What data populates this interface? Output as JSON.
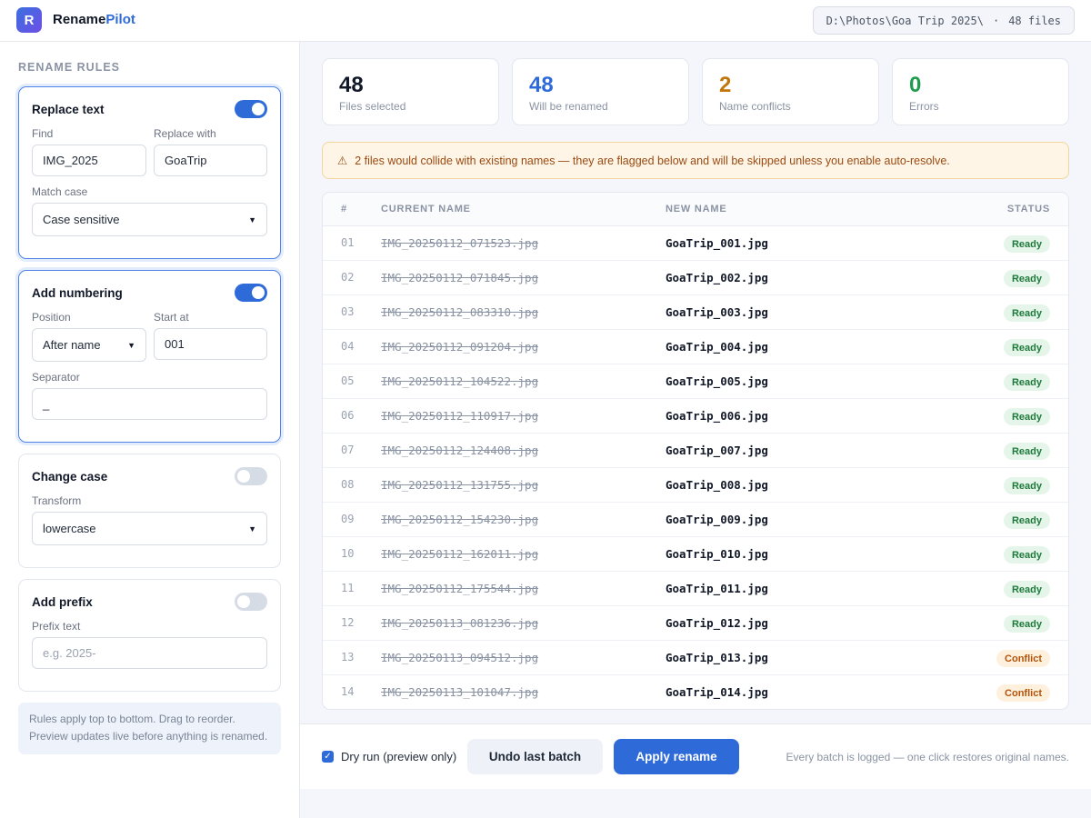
{
  "app": {
    "logo_letter": "R",
    "brand_main": "Rename",
    "brand_accent": "Pilot"
  },
  "header": {
    "path": "D:\\Photos\\Goa Trip 2025\\",
    "separator": "·",
    "file_count": "48 files"
  },
  "sidebar": {
    "title": "RENAME RULES",
    "rules": [
      {
        "name": "Replace text",
        "enabled": true,
        "find_label": "Find",
        "find_value": "IMG_2025",
        "replace_label": "Replace with",
        "replace_value": "GoaTrip",
        "match_label": "Match case",
        "match_value": "Case sensitive"
      },
      {
        "name": "Add numbering",
        "enabled": true,
        "position_label": "Position",
        "position_value": "After name",
        "start_label": "Start at",
        "start_value": "001",
        "separator_label": "Separator",
        "separator_value": "_"
      },
      {
        "name": "Change case",
        "enabled": false,
        "transform_label": "Transform",
        "transform_value": "lowercase"
      },
      {
        "name": "Add prefix",
        "enabled": false,
        "prefix_label": "Prefix text",
        "prefix_placeholder": "e.g. 2025-"
      }
    ],
    "note_line1": "Rules apply top to bottom. Drag to reorder.",
    "note_line2": "Preview updates live before anything is renamed."
  },
  "stats": [
    {
      "value": "48",
      "label": "Files selected",
      "color": "#111827"
    },
    {
      "value": "48",
      "label": "Will be renamed",
      "color": "#2f6bd8"
    },
    {
      "value": "2",
      "label": "Name conflicts",
      "color": "#c2760a"
    },
    {
      "value": "0",
      "label": "Errors",
      "color": "#1f9d4c"
    }
  ],
  "banner": {
    "icon": "warning-icon",
    "text": "2 files would collide with existing names — they are flagged below and will be skipped unless you enable auto-resolve."
  },
  "table": {
    "headers": {
      "num": "#",
      "current": "CURRENT NAME",
      "new": "NEW NAME",
      "status": "STATUS"
    },
    "rows": [
      {
        "num": "01",
        "current": "IMG_20250112_071523.jpg",
        "new": "GoaTrip_001.jpg",
        "status": "Ready"
      },
      {
        "num": "02",
        "current": "IMG_20250112_071845.jpg",
        "new": "GoaTrip_002.jpg",
        "status": "Ready"
      },
      {
        "num": "03",
        "current": "IMG_20250112_083310.jpg",
        "new": "GoaTrip_003.jpg",
        "status": "Ready"
      },
      {
        "num": "04",
        "current": "IMG_20250112_091204.jpg",
        "new": "GoaTrip_004.jpg",
        "status": "Ready"
      },
      {
        "num": "05",
        "current": "IMG_20250112_104522.jpg",
        "new": "GoaTrip_005.jpg",
        "status": "Ready"
      },
      {
        "num": "06",
        "current": "IMG_20250112_110917.jpg",
        "new": "GoaTrip_006.jpg",
        "status": "Ready"
      },
      {
        "num": "07",
        "current": "IMG_20250112_124408.jpg",
        "new": "GoaTrip_007.jpg",
        "status": "Ready"
      },
      {
        "num": "08",
        "current": "IMG_20250112_131755.jpg",
        "new": "GoaTrip_008.jpg",
        "status": "Ready"
      },
      {
        "num": "09",
        "current": "IMG_20250112_154230.jpg",
        "new": "GoaTrip_009.jpg",
        "status": "Ready"
      },
      {
        "num": "10",
        "current": "IMG_20250112_162011.jpg",
        "new": "GoaTrip_010.jpg",
        "status": "Ready"
      },
      {
        "num": "11",
        "current": "IMG_20250112_175544.jpg",
        "new": "GoaTrip_011.jpg",
        "status": "Ready"
      },
      {
        "num": "12",
        "current": "IMG_20250113_081236.jpg",
        "new": "GoaTrip_012.jpg",
        "status": "Ready"
      },
      {
        "num": "13",
        "current": "IMG_20250113_094512.jpg",
        "new": "GoaTrip_013.jpg",
        "status": "Conflict"
      },
      {
        "num": "14",
        "current": "IMG_20250113_101047.jpg",
        "new": "GoaTrip_014.jpg",
        "status": "Conflict"
      }
    ]
  },
  "footer": {
    "dry_run_label": "Dry run (preview only)",
    "dry_run_checked": true,
    "undo_label": "Undo last batch",
    "apply_label": "Apply rename",
    "note": "Every batch is logged — one click restores original names."
  }
}
